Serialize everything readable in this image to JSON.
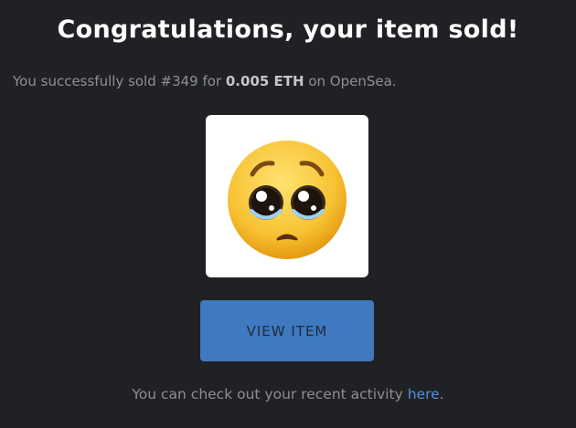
{
  "title": "Congratulations, your item sold!",
  "sale": {
    "prefix": "You successfully sold #349 for ",
    "price": "0.005 ETH",
    "suffix": " on OpenSea."
  },
  "item": {
    "image": "pleading-face-emoji"
  },
  "button": {
    "label": "VIEW ITEM"
  },
  "footer": {
    "prefix": "You can check out your recent activity ",
    "link": "here",
    "suffix": "."
  },
  "colors": {
    "background": "#202124",
    "button": "#3f79c0",
    "link": "#4f91e0"
  }
}
